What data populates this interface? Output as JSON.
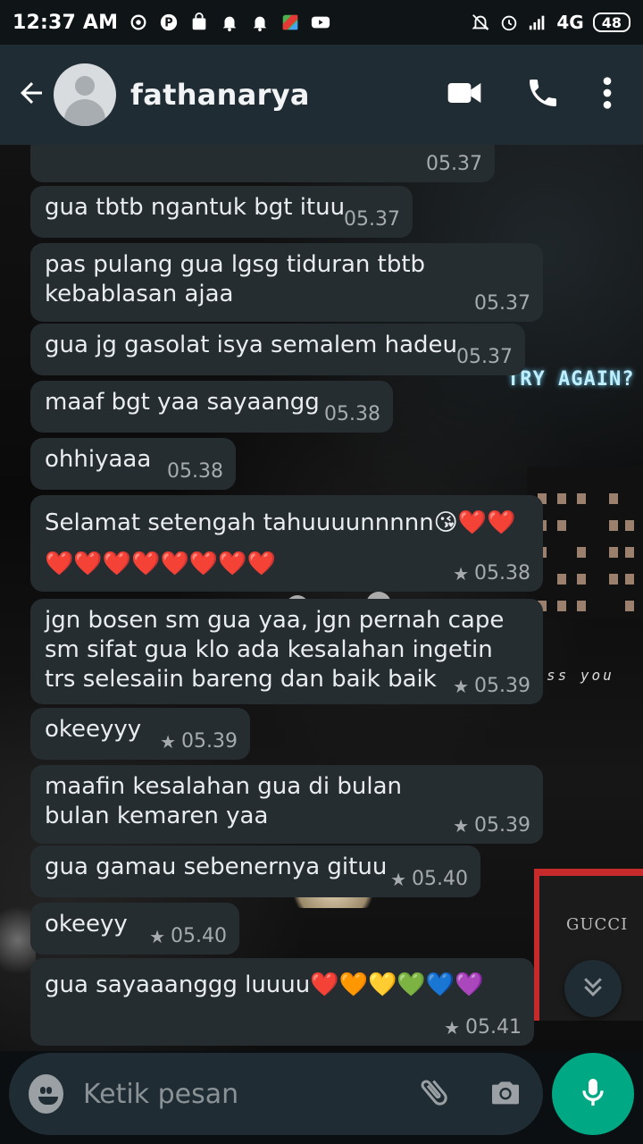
{
  "status_bar": {
    "time": "12:37 AM",
    "network": "4G",
    "battery": "48"
  },
  "header": {
    "contact_name": "fathanarya"
  },
  "background": {
    "neon_text": "TRY AGAIN?",
    "miss_text": "ss you",
    "store_text": "GUCCI"
  },
  "messages": [
    {
      "text": "",
      "time": "05.37",
      "starred": false
    },
    {
      "text": "gua tbtb ngantuk bgt ituu",
      "time": "05.37",
      "starred": false
    },
    {
      "text": "pas pulang gua lgsg tiduran tbtb kebablasan ajaa",
      "time": "05.37",
      "starred": false
    },
    {
      "text": "gua jg gasolat isya semalem hadeu",
      "time": "05.37",
      "starred": false
    },
    {
      "text": "maaf bgt yaa sayaangg",
      "time": "05.38",
      "starred": false
    },
    {
      "text": "ohhiyaaa",
      "time": "05.38",
      "starred": false
    },
    {
      "text": "Selamat setengah tahuuuunnnnn😘❤️❤️❤️❤️❤️❤️❤️❤️❤️❤️",
      "time": "05.38",
      "starred": true
    },
    {
      "text": "jgn bosen sm gua yaa, jgn pernah cape sm sifat gua klo ada kesalahan ingetin trs selesaiin bareng dan baik baik",
      "time": "05.39",
      "starred": true
    },
    {
      "text": "okeeyyy",
      "time": "05.39",
      "starred": true
    },
    {
      "text": "maafin kesalahan gua di bulan bulan kemaren yaa",
      "time": "05.39",
      "starred": true
    },
    {
      "text": "gua gamau sebenernya gituu",
      "time": "05.40",
      "starred": true
    },
    {
      "text": "okeeyy",
      "time": "05.40",
      "starred": true
    },
    {
      "text": "gua sayaaanggg luuuu❤️🧡💛💚💙💜",
      "time": "05.41",
      "starred": true
    }
  ],
  "composer": {
    "placeholder": "Ketik pesan"
  },
  "icons": {
    "back": "arrow-left-icon",
    "video": "video-call-icon",
    "call": "phone-icon",
    "menu": "more-vert-icon",
    "emoji": "emoji-icon",
    "attach": "paperclip-icon",
    "camera": "camera-icon",
    "mic": "mic-icon",
    "scroll": "double-chevron-down-icon"
  },
  "colors": {
    "header": "#1f2c34",
    "bubble": "#262d31",
    "accent": "#00a884"
  }
}
